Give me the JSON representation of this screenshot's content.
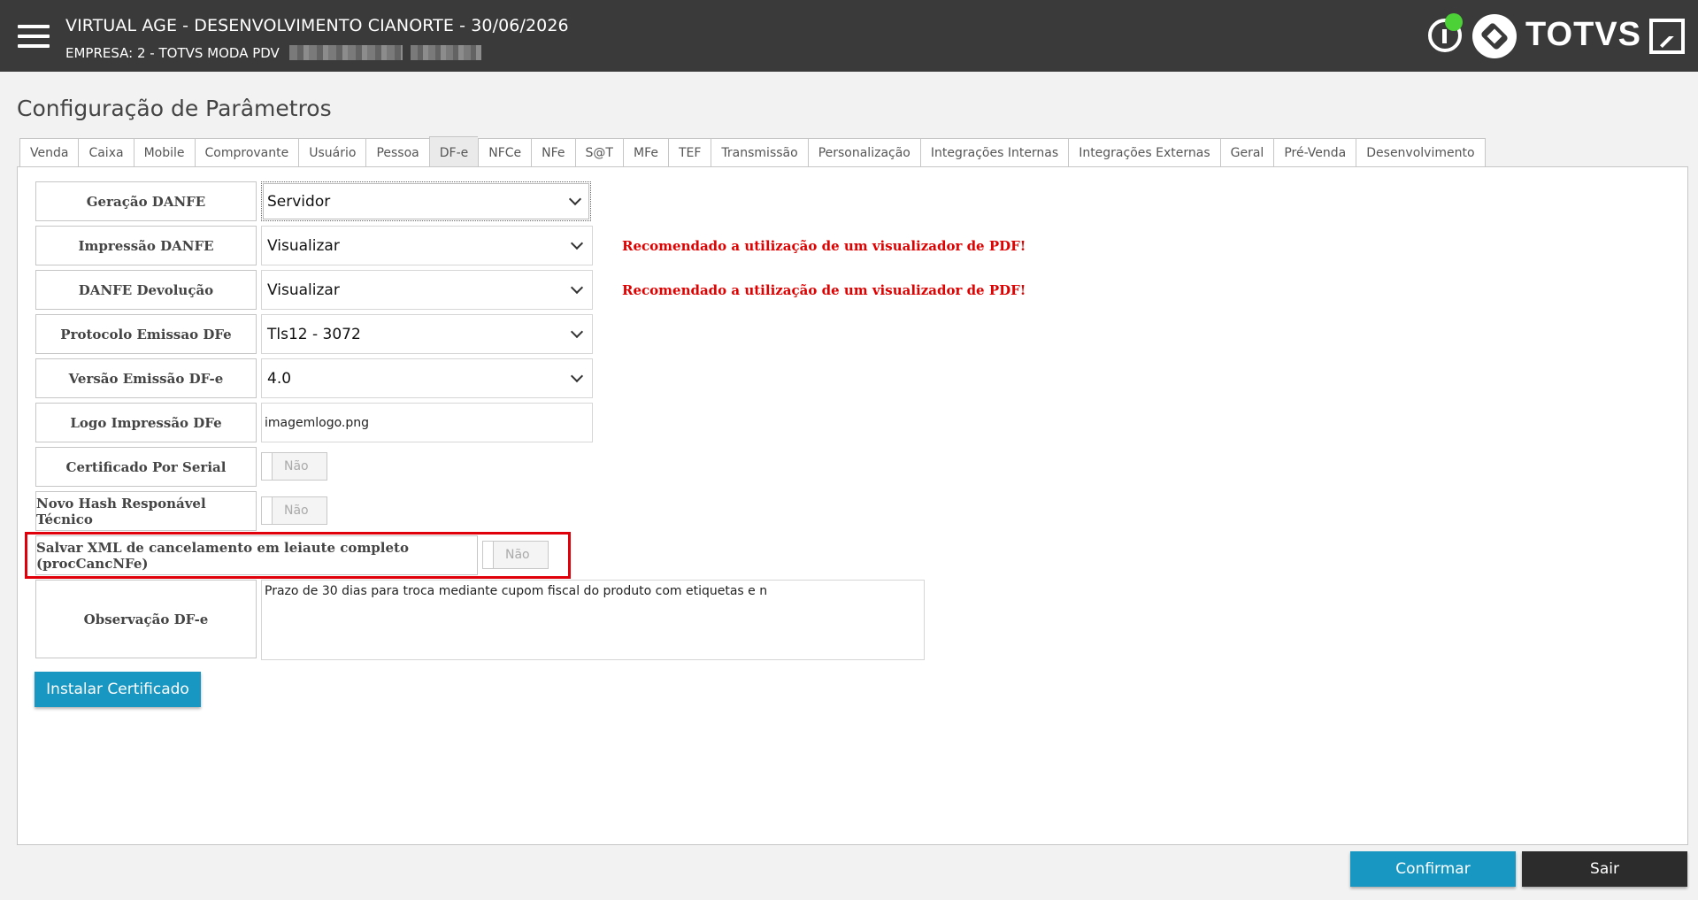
{
  "header": {
    "title": "VIRTUAL AGE - DESENVOLVIMENTO CIANORTE - 30/06/2026",
    "company": "EMPRESA: 2 - TOTVS MODA PDV",
    "brand": "TOTVS"
  },
  "page_title": "Configuração de Parâmetros",
  "tabs": [
    {
      "label": "Venda"
    },
    {
      "label": "Caixa"
    },
    {
      "label": "Mobile"
    },
    {
      "label": "Comprovante"
    },
    {
      "label": "Usuário"
    },
    {
      "label": "Pessoa"
    },
    {
      "label": "DF-e",
      "active": true
    },
    {
      "label": "NFCe"
    },
    {
      "label": "NFe"
    },
    {
      "label": "S@T"
    },
    {
      "label": "MFe"
    },
    {
      "label": "TEF"
    },
    {
      "label": "Transmissão"
    },
    {
      "label": "Personalização"
    },
    {
      "label": "Integrações Internas"
    },
    {
      "label": "Integrações Externas"
    },
    {
      "label": "Geral"
    },
    {
      "label": "Pré-Venda"
    },
    {
      "label": "Desenvolvimento"
    }
  ],
  "fields": {
    "geracao_danfe": {
      "label": "Geração DANFE",
      "value": "Servidor"
    },
    "impressao_danfe": {
      "label": "Impressão DANFE",
      "value": "Visualizar",
      "warning": "Recomendado a utilização de um visualizador de PDF!"
    },
    "danfe_devolucao": {
      "label": "DANFE Devolução",
      "value": "Visualizar",
      "warning": "Recomendado a utilização de um visualizador de PDF!"
    },
    "protocolo": {
      "label": "Protocolo Emissao DFe",
      "value": "Tls12 - 3072"
    },
    "versao": {
      "label": "Versão Emissão DF-e",
      "value": "4.0"
    },
    "logo": {
      "label": "Logo Impressão DFe",
      "value": "imagemlogo.png"
    },
    "cert_serial": {
      "label": "Certificado Por Serial",
      "value": "Não"
    },
    "novo_hash": {
      "label": "Novo Hash Responável Técnico",
      "value": "Não"
    },
    "salvar_xml": {
      "label": "Salvar XML de cancelamento em leiaute completo (procCancNFe)",
      "value": "Não"
    },
    "observacao": {
      "label": "Observação DF-e",
      "value": "Prazo de 30 dias para troca mediante cupom fiscal do produto com etiquetas e n"
    }
  },
  "buttons": {
    "install_cert": "Instalar Certificado",
    "confirm": "Confirmar",
    "exit": "Sair"
  },
  "colors": {
    "header_bg": "#3a3a3a",
    "accent": "#1897c2",
    "warning": "#e00000",
    "status_online": "#4cd137",
    "highlight": "#e0000a"
  }
}
